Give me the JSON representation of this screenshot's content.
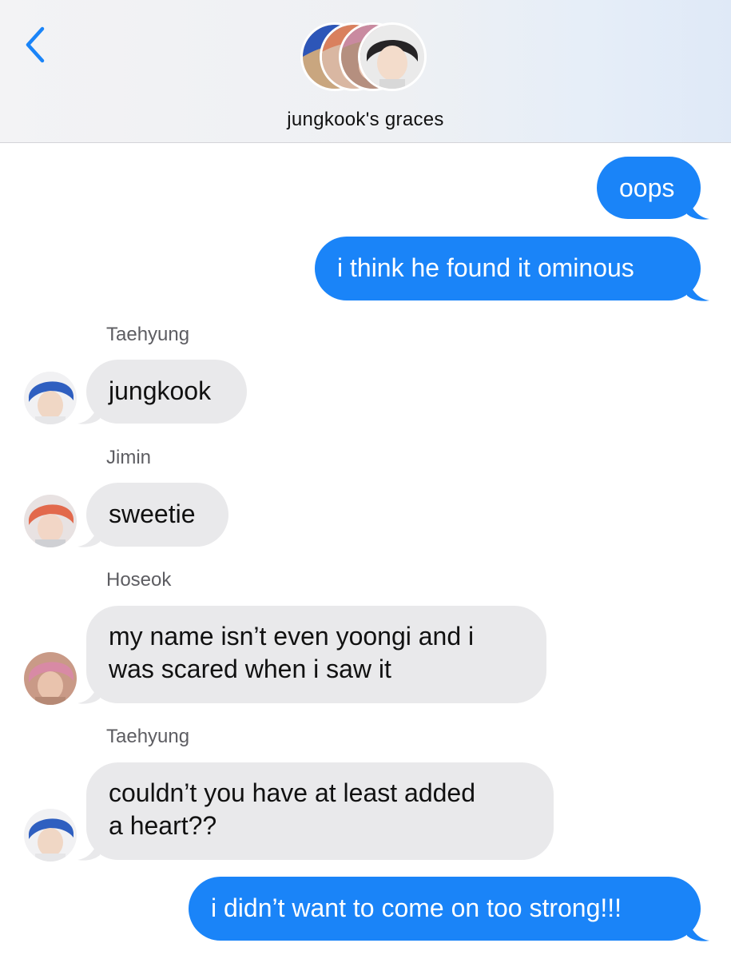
{
  "header": {
    "title": "jungkook's graces",
    "back_icon": "chevron-left-icon",
    "accent_color": "#1a84f8"
  },
  "messages": [
    {
      "direction": "outgoing",
      "text": "oops"
    },
    {
      "direction": "outgoing",
      "text": "i think he found it ominous"
    },
    {
      "direction": "incoming",
      "sender": "Taehyung",
      "text": "jungkook"
    },
    {
      "direction": "incoming",
      "sender": "Jimin",
      "text": "sweetie"
    },
    {
      "direction": "incoming",
      "sender": "Hoseok",
      "lines": [
        "my name isn’t even yoongi and i",
        "was scared when i saw it"
      ]
    },
    {
      "direction": "incoming",
      "sender": "Taehyung",
      "lines": [
        "couldn’t you have at least added",
        "a heart??"
      ]
    },
    {
      "direction": "outgoing",
      "text": "i didn’t want to come on too strong!!!"
    }
  ],
  "colors": {
    "outgoing_bubble": "#1a84f8",
    "incoming_bubble": "#e9e9eb",
    "sender_label": "#5d5d62"
  }
}
